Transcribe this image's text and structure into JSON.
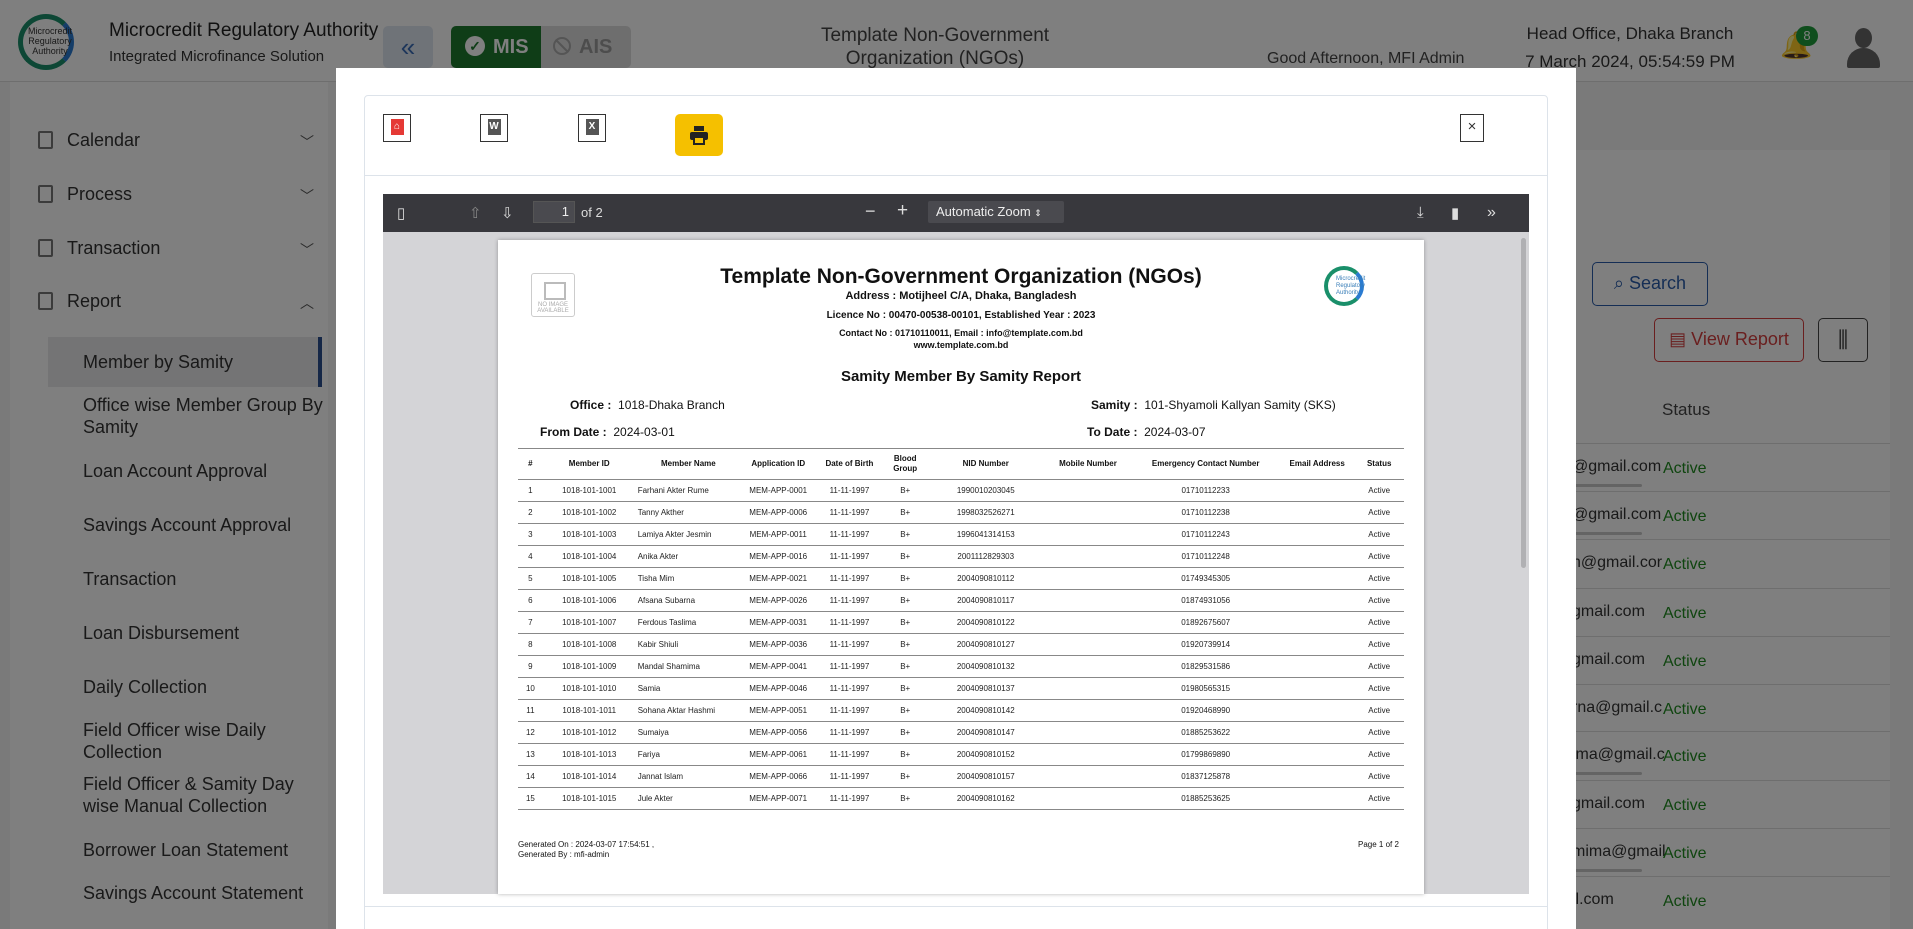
{
  "header": {
    "logo_text": "Microcredit Regulatory Authority",
    "brand_title": "Microcredit Regulatory Authority",
    "brand_subtitle": "Integrated Microfinance Solution",
    "mis_label": "MIS",
    "ais_label": "AIS",
    "center_title": "Template Non-Government Organization (NGOs)",
    "greeting": "Good Afternoon, MFI Admin",
    "office": "Head Office, Dhaka Branch",
    "datetime": "7 March 2024, 05:54:59 PM",
    "notification_count": "8"
  },
  "sidebar": {
    "sections": [
      {
        "label": "Calendar",
        "icon": "document-icon"
      },
      {
        "label": "Process",
        "icon": "document-icon"
      },
      {
        "label": "Transaction",
        "icon": "document-icon"
      },
      {
        "label": "Report",
        "icon": "document-icon"
      }
    ],
    "report_items": [
      "Member by Samity",
      "Office wise Member Group By Samity",
      "Loan Account Approval",
      "Savings Account Approval",
      "Transaction",
      "Loan Disbursement",
      "Daily Collection",
      "Field Officer wise Daily Collection",
      "Field Officer & Samity Day wise Manual Collection",
      "Borrower Loan Statement",
      "Savings Account Statement"
    ]
  },
  "main": {
    "search_label": "Search",
    "view_report_label": "View Report",
    "status_header": "Status",
    "rows": [
      {
        "email": "@gmail.com",
        "status": "Active"
      },
      {
        "email": "@gmail.com",
        "status": "Active"
      },
      {
        "email": "n@gmail.cor",
        "status": "Active"
      },
      {
        "email": "gmail.com",
        "status": "Active"
      },
      {
        "email": "gmail.com",
        "status": "Active"
      },
      {
        "email": "rna@gmail.c",
        "status": "Active"
      },
      {
        "email": "ima@gmail.c",
        "status": "Active"
      },
      {
        "email": "gmail.com",
        "status": "Active"
      },
      {
        "email": "mima@gmail",
        "status": "Active"
      },
      {
        "email": "il.com",
        "status": "Active"
      }
    ]
  },
  "modal": {
    "close_label": "×",
    "viewer": {
      "page_number": "1",
      "page_of": "of 2",
      "zoom": "Automatic Zoom"
    },
    "report": {
      "no_image_text": "NO IMAGE AVAILABLE",
      "title": "Template Non-Government Organization (NGOs)",
      "address": "Address : Motijheel C/A, Dhaka, Bangladesh",
      "licence": "Licence No : 00470-00538-00101,  Established Year : 2023",
      "contact": "Contact No : 01710110011, Email : info@template.com.bd",
      "website": "www.template.com.bd",
      "logo_text": "Microcredit Regulatory Authority",
      "subtitle": "Samity Member By Samity Report",
      "office_label": "Office :",
      "office_value": "1018-Dhaka Branch",
      "samity_label": "Samity :",
      "samity_value": "101-Shyamoli Kallyan Samity (SKS)",
      "from_label": "From Date :",
      "from_value": "2024-03-01",
      "to_label": "To Date :",
      "to_value": "2024-03-07",
      "columns": [
        "#",
        "Member ID",
        "Member Name",
        "Application ID",
        "Date of Birth",
        "Blood Group",
        "NID Number",
        "Mobile Number",
        "Emergency Contact Number",
        "Email Address",
        "Status"
      ],
      "rows": [
        [
          "1",
          "1018-101-1001",
          "Farhani Akter Rume",
          "MEM-APP-0001",
          "11-11-1997",
          "B+",
          "1990010203045",
          "",
          "01710112233",
          "",
          "Active"
        ],
        [
          "2",
          "1018-101-1002",
          "Tanny Akther",
          "MEM-APP-0006",
          "11-11-1997",
          "B+",
          "1998032526271",
          "",
          "01710112238",
          "",
          "Active"
        ],
        [
          "3",
          "1018-101-1003",
          "Lamiya Akter Jesmin",
          "MEM-APP-0011",
          "11-11-1997",
          "B+",
          "1996041314153",
          "",
          "01710112243",
          "",
          "Active"
        ],
        [
          "4",
          "1018-101-1004",
          "Anika Akter",
          "MEM-APP-0016",
          "11-11-1997",
          "B+",
          "2001112829303",
          "",
          "01710112248",
          "",
          "Active"
        ],
        [
          "5",
          "1018-101-1005",
          "Tisha Mim",
          "MEM-APP-0021",
          "11-11-1997",
          "B+",
          "2004090810112",
          "",
          "01749345305",
          "",
          "Active"
        ],
        [
          "6",
          "1018-101-1006",
          "Afsana Subarna",
          "MEM-APP-0026",
          "11-11-1997",
          "B+",
          "2004090810117",
          "",
          "01874931056",
          "",
          "Active"
        ],
        [
          "7",
          "1018-101-1007",
          "Ferdous Taslima",
          "MEM-APP-0031",
          "11-11-1997",
          "B+",
          "2004090810122",
          "",
          "01892675607",
          "",
          "Active"
        ],
        [
          "8",
          "1018-101-1008",
          "Kabir Shiuli",
          "MEM-APP-0036",
          "11-11-1997",
          "B+",
          "2004090810127",
          "",
          "01920739914",
          "",
          "Active"
        ],
        [
          "9",
          "1018-101-1009",
          "Mandal Shamima",
          "MEM-APP-0041",
          "11-11-1997",
          "B+",
          "2004090810132",
          "",
          "01829531586",
          "",
          "Active"
        ],
        [
          "10",
          "1018-101-1010",
          "Samia",
          "MEM-APP-0046",
          "11-11-1997",
          "B+",
          "2004090810137",
          "",
          "01980565315",
          "",
          "Active"
        ],
        [
          "11",
          "1018-101-1011",
          "Sohana Aktar Hashmi",
          "MEM-APP-0051",
          "11-11-1997",
          "B+",
          "2004090810142",
          "",
          "01920468990",
          "",
          "Active"
        ],
        [
          "12",
          "1018-101-1012",
          "Sumaiya",
          "MEM-APP-0056",
          "11-11-1997",
          "B+",
          "2004090810147",
          "",
          "01885253622",
          "",
          "Active"
        ],
        [
          "13",
          "1018-101-1013",
          "Fariya",
          "MEM-APP-0061",
          "11-11-1997",
          "B+",
          "2004090810152",
          "",
          "01799869890",
          "",
          "Active"
        ],
        [
          "14",
          "1018-101-1014",
          "Jannat Islam",
          "MEM-APP-0066",
          "11-11-1997",
          "B+",
          "2004090810157",
          "",
          "01837125878",
          "",
          "Active"
        ],
        [
          "15",
          "1018-101-1015",
          "Jule Akter",
          "MEM-APP-0071",
          "11-11-1997",
          "B+",
          "2004090810162",
          "",
          "01885253625",
          "",
          "Active"
        ]
      ],
      "generated_on": "Generated On : 2024-03-07 17:54:51 ,",
      "generated_by": "Generated By : mfi-admin",
      "page_label": "Page 1 of 2"
    }
  }
}
